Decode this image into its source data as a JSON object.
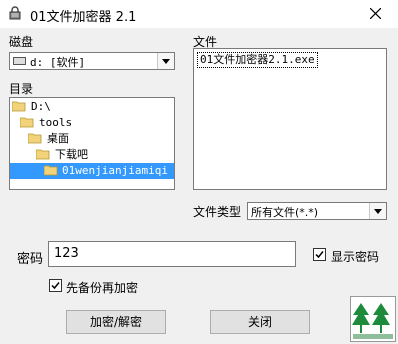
{
  "window": {
    "title": "01文件加密器 2.1"
  },
  "drive": {
    "label": "磁盘",
    "selected": "d: [软件]"
  },
  "files": {
    "label": "文件",
    "items": [
      "01文件加密器2.1.exe"
    ]
  },
  "directory": {
    "label": "目录",
    "items": [
      {
        "name": "D:\\",
        "selected": false
      },
      {
        "name": "tools",
        "selected": false
      },
      {
        "name": "桌面",
        "selected": false
      },
      {
        "name": "下载吧",
        "selected": false
      },
      {
        "name": "01wenjianjiamiqi",
        "selected": true
      }
    ]
  },
  "filetype": {
    "label": "文件类型",
    "selected": "所有文件(*.*)"
  },
  "password": {
    "label": "密码",
    "value": "123"
  },
  "show_password": {
    "label": "显示密码",
    "checked": true
  },
  "backup_first": {
    "label": "先备份再加密",
    "checked": true
  },
  "buttons": {
    "encrypt": "加密/解密",
    "close": "关闭"
  },
  "colors": {
    "selection": "#3399ff",
    "folder": "#f2d27a"
  }
}
